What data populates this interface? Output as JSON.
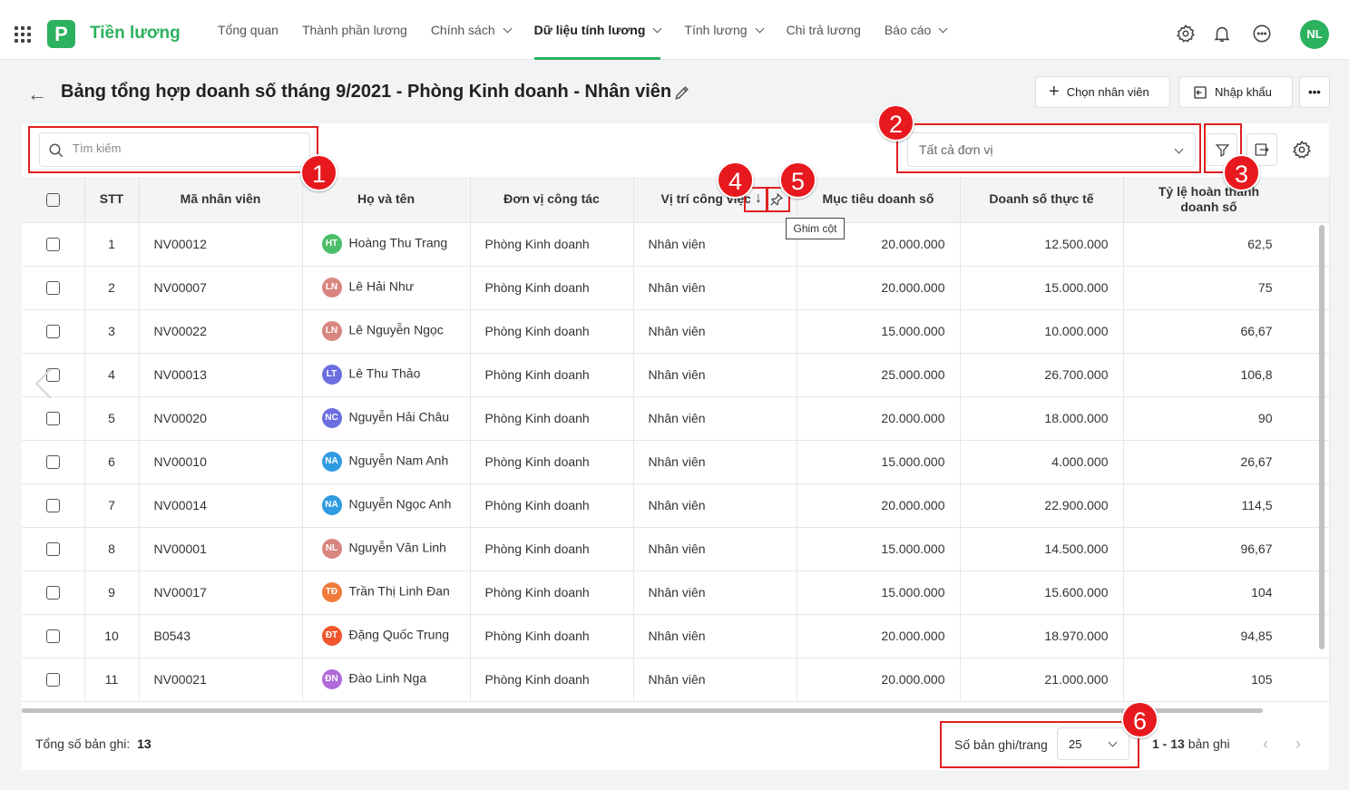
{
  "app": {
    "name": "Tiền lương",
    "logo_letter": "P",
    "user_initials": "NL"
  },
  "nav": [
    {
      "label": "Tổng quan",
      "dropdown": false,
      "active": false
    },
    {
      "label": "Thành phần lương",
      "dropdown": false,
      "active": false
    },
    {
      "label": "Chính sách",
      "dropdown": true,
      "active": false
    },
    {
      "label": "Dữ liệu tính lương",
      "dropdown": true,
      "active": true
    },
    {
      "label": "Tính lương",
      "dropdown": true,
      "active": false
    },
    {
      "label": "Chi trả lương",
      "dropdown": false,
      "active": false
    },
    {
      "label": "Báo cáo",
      "dropdown": true,
      "active": false
    }
  ],
  "page": {
    "title": "Bảng tổng hợp doanh số tháng 9/2021 - Phòng Kinh doanh - Nhân viên",
    "select_employee_label": "Chọn nhân viên",
    "import_label": "Nhập khẩu",
    "more_label": "•••"
  },
  "toolbar": {
    "search_placeholder": "Tìm kiếm",
    "unit_filter_value": "Tất cả đơn vị"
  },
  "table": {
    "headers": [
      "STT",
      "Mã nhân viên",
      "Họ và tên",
      "Đơn vị công tác",
      "Vị trí công việc",
      "Mục tiêu doanh số",
      "Doanh số thực tế",
      "Tỷ lệ hoàn thành doanh số"
    ],
    "rows": [
      {
        "stt": "1",
        "code": "NV00012",
        "initials": "HT",
        "avatar_color": "#4cbf6a",
        "name": "Hoàng Thu Trang",
        "unit": "Phòng Kinh doanh",
        "position": "Nhân viên",
        "target": "20.000.000",
        "actual": "12.500.000",
        "rate": "62,5"
      },
      {
        "stt": "2",
        "code": "NV00007",
        "initials": "LN",
        "avatar_color": "#d98680",
        "name": "Lê Hải Như",
        "unit": "Phòng Kinh doanh",
        "position": "Nhân viên",
        "target": "20.000.000",
        "actual": "15.000.000",
        "rate": "75"
      },
      {
        "stt": "3",
        "code": "NV00022",
        "initials": "LN",
        "avatar_color": "#d98680",
        "name": "Lê Nguyễn Ngọc",
        "unit": "Phòng Kinh doanh",
        "position": "Nhân viên",
        "target": "15.000.000",
        "actual": "10.000.000",
        "rate": "66,67"
      },
      {
        "stt": "4",
        "code": "NV00013",
        "initials": "LT",
        "avatar_color": "#6b6ee0",
        "name": "Lê Thu Thảo",
        "unit": "Phòng Kinh doanh",
        "position": "Nhân viên",
        "target": "25.000.000",
        "actual": "26.700.000",
        "rate": "106,8"
      },
      {
        "stt": "5",
        "code": "NV00020",
        "initials": "NC",
        "avatar_color": "#6b6ee0",
        "name": "Nguyễn Hải Châu",
        "unit": "Phòng Kinh doanh",
        "position": "Nhân viên",
        "target": "20.000.000",
        "actual": "18.000.000",
        "rate": "90"
      },
      {
        "stt": "6",
        "code": "NV00010",
        "initials": "NA",
        "avatar_color": "#2f9be0",
        "name": "Nguyễn Nam Anh",
        "unit": "Phòng Kinh doanh",
        "position": "Nhân viên",
        "target": "15.000.000",
        "actual": "4.000.000",
        "rate": "26,67"
      },
      {
        "stt": "7",
        "code": "NV00014",
        "initials": "NA",
        "avatar_color": "#2f9be0",
        "name": "Nguyễn Ngọc Anh",
        "unit": "Phòng Kinh doanh",
        "position": "Nhân viên",
        "target": "20.000.000",
        "actual": "22.900.000",
        "rate": "114,5"
      },
      {
        "stt": "8",
        "code": "NV00001",
        "initials": "NL",
        "avatar_color": "#d98680",
        "name": "Nguyễn Văn Linh",
        "unit": "Phòng Kinh doanh",
        "position": "Nhân viên",
        "target": "15.000.000",
        "actual": "14.500.000",
        "rate": "96,67"
      },
      {
        "stt": "9",
        "code": "NV00017",
        "initials": "TĐ",
        "avatar_color": "#f07a3a",
        "name": "Trần Thị Linh Đan",
        "unit": "Phòng Kinh doanh",
        "position": "Nhân viên",
        "target": "15.000.000",
        "actual": "15.600.000",
        "rate": "104"
      },
      {
        "stt": "10",
        "code": "B0543",
        "initials": "ĐT",
        "avatar_color": "#f0562e",
        "name": "Đặng Quốc Trung",
        "unit": "Phòng Kinh doanh",
        "position": "Nhân viên",
        "target": "20.000.000",
        "actual": "18.970.000",
        "rate": "94,85"
      },
      {
        "stt": "11",
        "code": "NV00021",
        "initials": "ĐN",
        "avatar_color": "#b06ad8",
        "name": "Đào Linh Nga",
        "unit": "Phòng Kinh doanh",
        "position": "Nhân viên",
        "target": "20.000.000",
        "actual": "21.000.000",
        "rate": "105"
      }
    ]
  },
  "tooltip": "Ghim cột",
  "footer": {
    "total_label": "Tổng số bản ghi:",
    "total_value": "13",
    "per_page_label": "Số bản ghi/trang",
    "per_page_value": "25",
    "range_bold": "1 - 13",
    "range_suffix": "bản ghi"
  },
  "annotations": [
    "1",
    "2",
    "3",
    "4",
    "5",
    "6"
  ],
  "colors": {
    "brand": "#2cb25e",
    "annotation": "#e02020"
  }
}
